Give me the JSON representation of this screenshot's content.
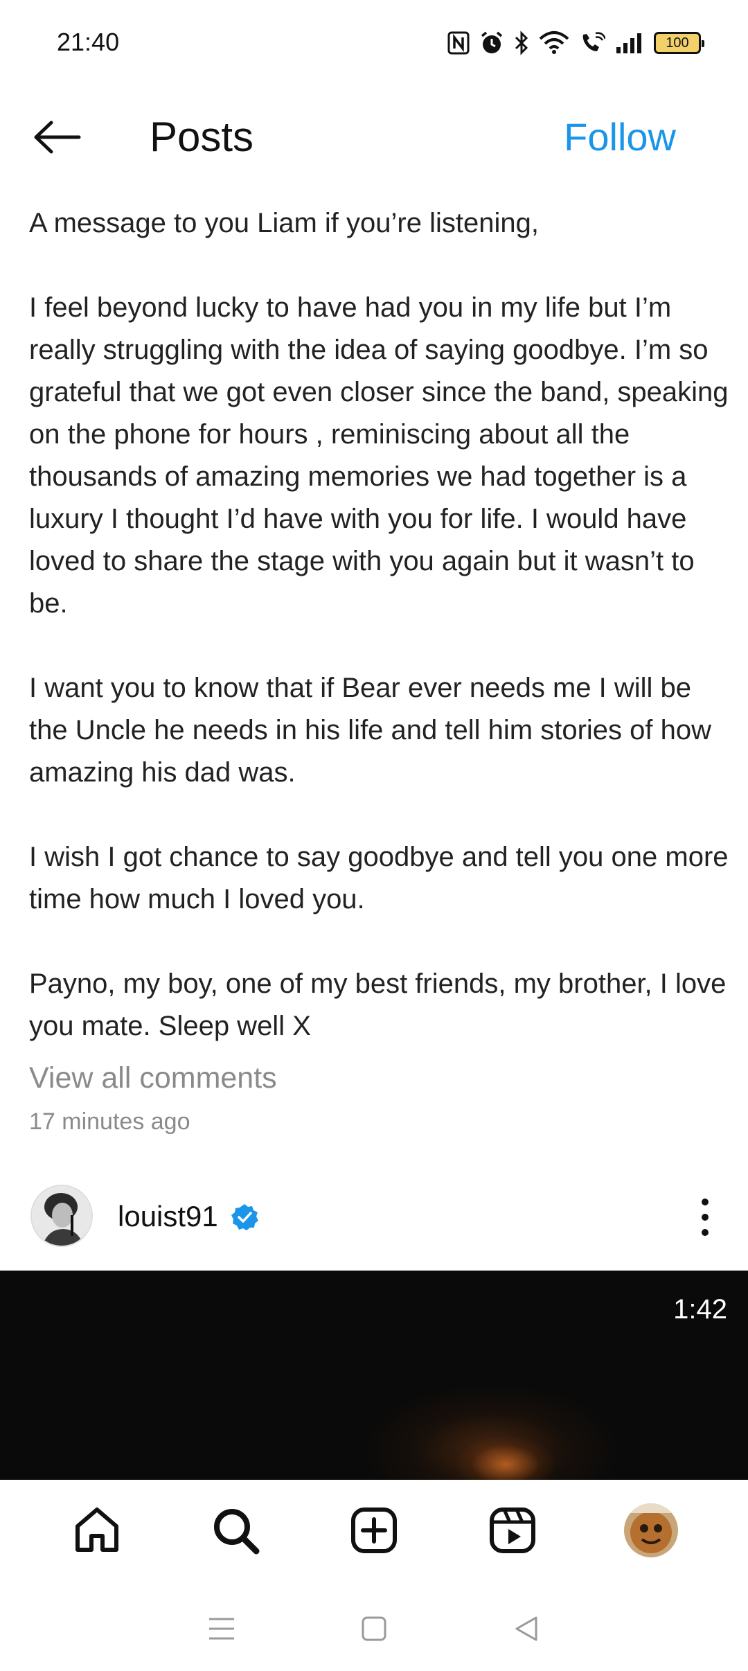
{
  "status_bar": {
    "time": "21:40",
    "battery": "100",
    "icons": [
      "nfc-icon",
      "alarm-icon",
      "bluetooth-icon",
      "wifi-icon",
      "wifi-calling-icon",
      "signal-icon",
      "battery-icon"
    ]
  },
  "header": {
    "title": "Posts",
    "follow_label": "Follow"
  },
  "caption": {
    "paragraphs": [
      "A message to you Liam if you’re listening,",
      "I feel beyond lucky to have had you in my life but I’m really struggling with the idea of saying goodbye. I’m so grateful that we got even closer since the band, speaking on the phone for hours , reminiscing about all the thousands of amazing memories we had together is a luxury I thought I’d have with you for life. I would have loved to share the stage with you again but it wasn’t to be.",
      "I want you to know that if Bear ever needs me I will be the Uncle he needs in his life and tell him stories of how amazing his dad was.",
      "I wish I got chance to say goodbye and tell you one more time how much I loved you.",
      "Payno, my boy, one of my best friends, my brother, I love you mate. Sleep well X"
    ]
  },
  "post_meta": {
    "view_comments": "View all comments",
    "timestamp": "17 minutes ago"
  },
  "next_post": {
    "username": "louist91",
    "verified": true,
    "video_duration": "1:42"
  },
  "bottom_nav": {
    "items": [
      "home-icon",
      "search-icon",
      "create-icon",
      "reels-icon",
      "profile-avatar"
    ]
  },
  "system_nav": {
    "items": [
      "recents-icon",
      "home-icon",
      "back-icon"
    ]
  },
  "colors": {
    "accent": "#1a95e9",
    "muted": "#8a8a8a",
    "verified": "#1a95e9"
  }
}
